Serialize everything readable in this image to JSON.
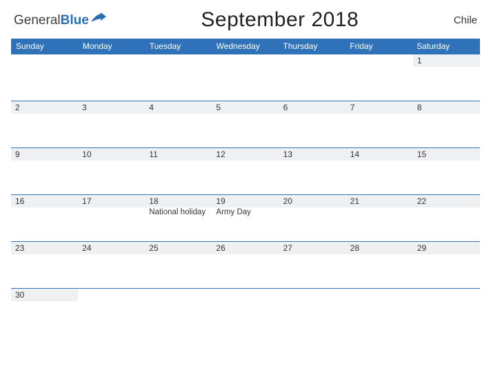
{
  "logo": {
    "part1": "General",
    "part2": "Blue"
  },
  "title": "September 2018",
  "country": "Chile",
  "day_headers": [
    "Sunday",
    "Monday",
    "Tuesday",
    "Wednesday",
    "Thursday",
    "Friday",
    "Saturday"
  ],
  "weeks": [
    [
      {
        "date": "",
        "event": ""
      },
      {
        "date": "",
        "event": ""
      },
      {
        "date": "",
        "event": ""
      },
      {
        "date": "",
        "event": ""
      },
      {
        "date": "",
        "event": ""
      },
      {
        "date": "",
        "event": ""
      },
      {
        "date": "1",
        "event": ""
      }
    ],
    [
      {
        "date": "2",
        "event": ""
      },
      {
        "date": "3",
        "event": ""
      },
      {
        "date": "4",
        "event": ""
      },
      {
        "date": "5",
        "event": ""
      },
      {
        "date": "6",
        "event": ""
      },
      {
        "date": "7",
        "event": ""
      },
      {
        "date": "8",
        "event": ""
      }
    ],
    [
      {
        "date": "9",
        "event": ""
      },
      {
        "date": "10",
        "event": ""
      },
      {
        "date": "11",
        "event": ""
      },
      {
        "date": "12",
        "event": ""
      },
      {
        "date": "13",
        "event": ""
      },
      {
        "date": "14",
        "event": ""
      },
      {
        "date": "15",
        "event": ""
      }
    ],
    [
      {
        "date": "16",
        "event": ""
      },
      {
        "date": "17",
        "event": ""
      },
      {
        "date": "18",
        "event": "National holiday"
      },
      {
        "date": "19",
        "event": "Army Day"
      },
      {
        "date": "20",
        "event": ""
      },
      {
        "date": "21",
        "event": ""
      },
      {
        "date": "22",
        "event": ""
      }
    ],
    [
      {
        "date": "23",
        "event": ""
      },
      {
        "date": "24",
        "event": ""
      },
      {
        "date": "25",
        "event": ""
      },
      {
        "date": "26",
        "event": ""
      },
      {
        "date": "27",
        "event": ""
      },
      {
        "date": "28",
        "event": ""
      },
      {
        "date": "29",
        "event": ""
      }
    ],
    [
      {
        "date": "30",
        "event": ""
      },
      {
        "date": "",
        "event": ""
      },
      {
        "date": "",
        "event": ""
      },
      {
        "date": "",
        "event": ""
      },
      {
        "date": "",
        "event": ""
      },
      {
        "date": "",
        "event": ""
      },
      {
        "date": "",
        "event": ""
      }
    ]
  ]
}
